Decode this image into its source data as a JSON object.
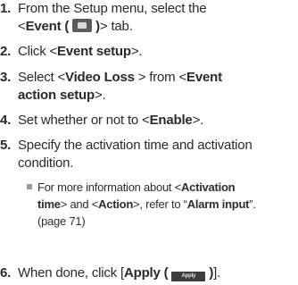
{
  "steps": [
    {
      "num": "1.",
      "line1": "From the Setup menu, select the",
      "pre": "<",
      "event_tab": "Event (",
      "event_tab_close": ")",
      "post": "> tab."
    },
    {
      "num": "2.",
      "pre": "Click <",
      "bold": "Event setup",
      "post": ">."
    },
    {
      "num": "3.",
      "pre": "Select <",
      "bold1": "Video Loss",
      "mid": " > from <",
      "bold2a": "Event",
      "bold2b": "action setup",
      "post": ">."
    },
    {
      "num": "4.",
      "pre": "Set whether or not to <",
      "bold": "Enable",
      "post": ">."
    },
    {
      "num": "5.",
      "line1": "Specify the activation time and activation",
      "line2": "condition."
    },
    {
      "num": "6.",
      "pre": "When done, click [",
      "bold": "Apply (",
      "bold_close": ")",
      "post": "]."
    }
  ],
  "note": {
    "t1": "For more information about <",
    "b1": "Activation",
    "b2": "time",
    "t2": "> and <",
    "b3": "Action",
    "t3": ">, refer to “",
    "b4": "Alarm input",
    "t4": "”.",
    "t5": "(page 71)"
  },
  "icons": {
    "event_tab": "event-camera-icon",
    "apply_button": "apply-button-icon",
    "apply_label": "Apply"
  }
}
